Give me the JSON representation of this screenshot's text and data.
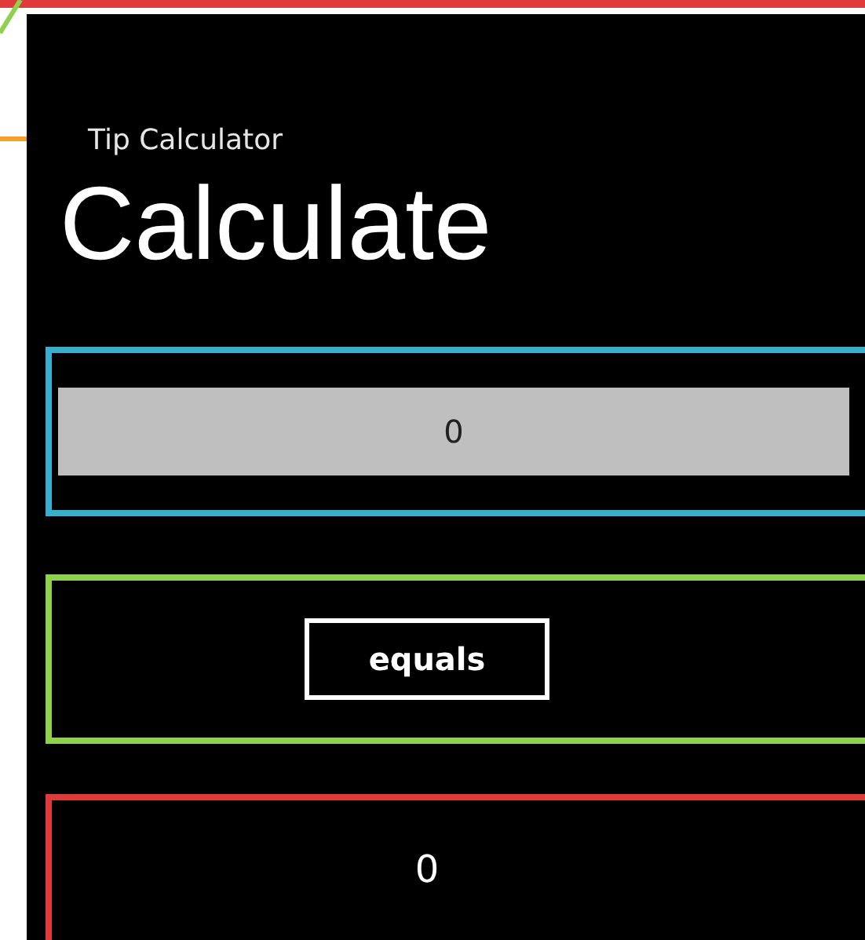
{
  "app_title": "Tip Calculator",
  "page_title": "Calculate",
  "amount_field": {
    "value": "0"
  },
  "equals_button": {
    "label": "equals"
  },
  "result": {
    "value": "0"
  }
}
